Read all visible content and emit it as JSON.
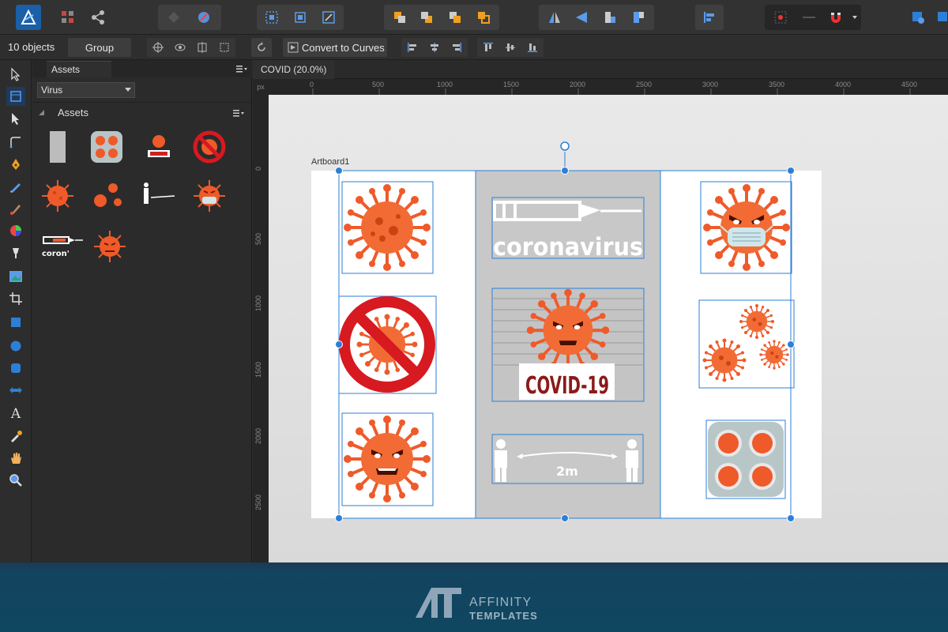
{
  "toolbar": {
    "items": [
      "affinity-designer-logo",
      "designer-persona",
      "pixel-persona",
      "share-icon",
      "boolean-ops",
      "grid-ops",
      "arrange",
      "flip",
      "align",
      "snapping"
    ]
  },
  "context_bar": {
    "selection_count": "10 objects",
    "group_label": "Group",
    "convert_label": "Convert to Curves"
  },
  "assets_panel": {
    "tab_label": "Assets",
    "category": "Virus",
    "subcategory": "Assets",
    "items": [
      "rectangle",
      "pill-blister",
      "covid-19-badge",
      "no-virus-sign",
      "virus",
      "virus-cluster",
      "social-distance",
      "masked-virus",
      "coronavirus-syringe",
      "angry-virus"
    ]
  },
  "document": {
    "tab_title": "COVID (20.0%)",
    "ruler_unit": "px",
    "artboard_label": "Artboard1",
    "h_ticks": [
      "0",
      "500",
      "1000",
      "1500",
      "2000",
      "2500",
      "3000",
      "3500",
      "4000",
      "4500"
    ],
    "v_ticks": [
      "0",
      "500",
      "1000",
      "1500",
      "2000",
      "2500"
    ],
    "center_texts": {
      "coronavirus": "coronavirus",
      "covid": "COVID-19",
      "distance": "2m"
    }
  },
  "footer": {
    "brand_line1": "AFFINITY",
    "brand_line2": "TEMPLATES"
  },
  "colors": {
    "virus": "#ef5a2a",
    "virus_light": "#f4855a",
    "accent": "#2d7fd6",
    "selection": "#2d7fd6",
    "footer": "#0f4660"
  }
}
